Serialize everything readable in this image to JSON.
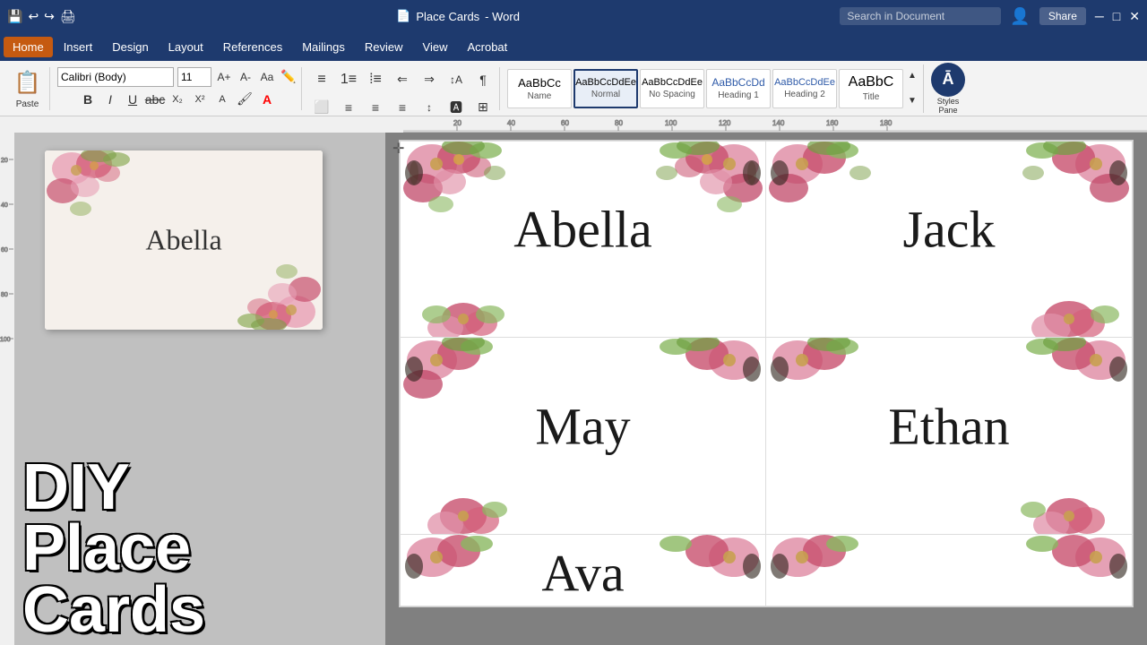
{
  "titlebar": {
    "title": "Place Cards",
    "search_placeholder": "Search in Document",
    "icon": "📄"
  },
  "menubar": {
    "items": [
      "Home",
      "Insert",
      "Design",
      "Layout",
      "References",
      "Mailings",
      "Review",
      "View",
      "Acrobat"
    ],
    "active": "Home",
    "share_label": "Share"
  },
  "toolbar": {
    "paste_label": "Paste",
    "font_name": "Calibri (Body)",
    "font_size": "11",
    "bold": "B",
    "italic": "I",
    "underline": "U",
    "styles_pane_label": "Styles\nPane"
  },
  "styles": {
    "items": [
      {
        "id": "name",
        "preview": "AaBbCc",
        "label": "Name"
      },
      {
        "id": "normal",
        "preview": "AaBbCcDdEe",
        "label": "Normal",
        "active": true
      },
      {
        "id": "no-spacing",
        "preview": "AaBbCcDdEe",
        "label": "No Spacing"
      },
      {
        "id": "heading1",
        "preview": "AaBbCcDd",
        "label": "Heading 1"
      },
      {
        "id": "heading2",
        "preview": "AaBbCcDdEe",
        "label": "Heading 2"
      },
      {
        "id": "title",
        "preview": "AaBbC",
        "label": "Title"
      }
    ]
  },
  "place_cards": {
    "names": [
      "Abella",
      "Jack",
      "May",
      "Ethan",
      "Ava",
      ""
    ],
    "diy_line1": "DIY",
    "diy_line2": "Place Cards"
  },
  "thumbnail": {
    "name": "Abella"
  },
  "ruler_marks": [
    "20",
    "40",
    "60",
    "80",
    "100",
    "120",
    "140",
    "160",
    "180"
  ]
}
